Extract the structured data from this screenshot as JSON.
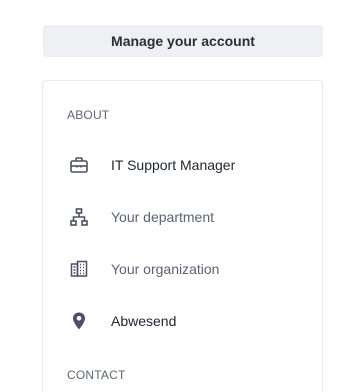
{
  "manage_account": {
    "label": "Manage your account"
  },
  "about": {
    "heading": "ABOUT",
    "items": [
      {
        "icon": "briefcase-icon",
        "label": "IT Support Manager"
      },
      {
        "icon": "org-chart-icon",
        "label": "Your department"
      },
      {
        "icon": "building-icon",
        "label": "Your organization"
      },
      {
        "icon": "location-pin-icon",
        "label": "Abwesend"
      }
    ]
  },
  "contact": {
    "heading": "CONTACT"
  },
  "colors": {
    "button_bg": "#eef0f3",
    "icon": "#4a5160",
    "text_primary": "#1f2530",
    "text_muted": "#5b6273"
  }
}
